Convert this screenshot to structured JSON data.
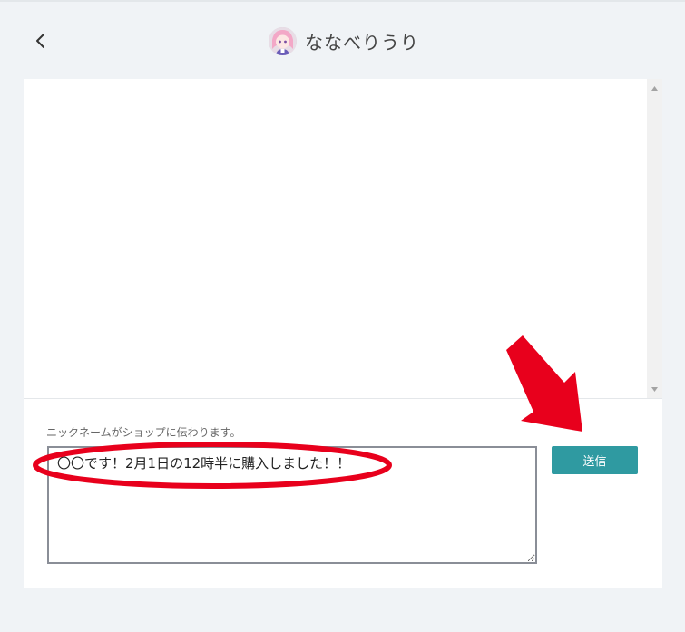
{
  "header": {
    "back_icon": "chevron-left-icon",
    "shop_name": "ななべりうり"
  },
  "compose": {
    "hint": "ニックネームがショップに伝わります。",
    "message_value": "〇〇です！2月1日の12時半に購入しました！！",
    "send_label": "送信"
  },
  "colors": {
    "background": "#f0f3f6",
    "send_button": "#2f9aa1",
    "annotation": "#e8001c"
  }
}
